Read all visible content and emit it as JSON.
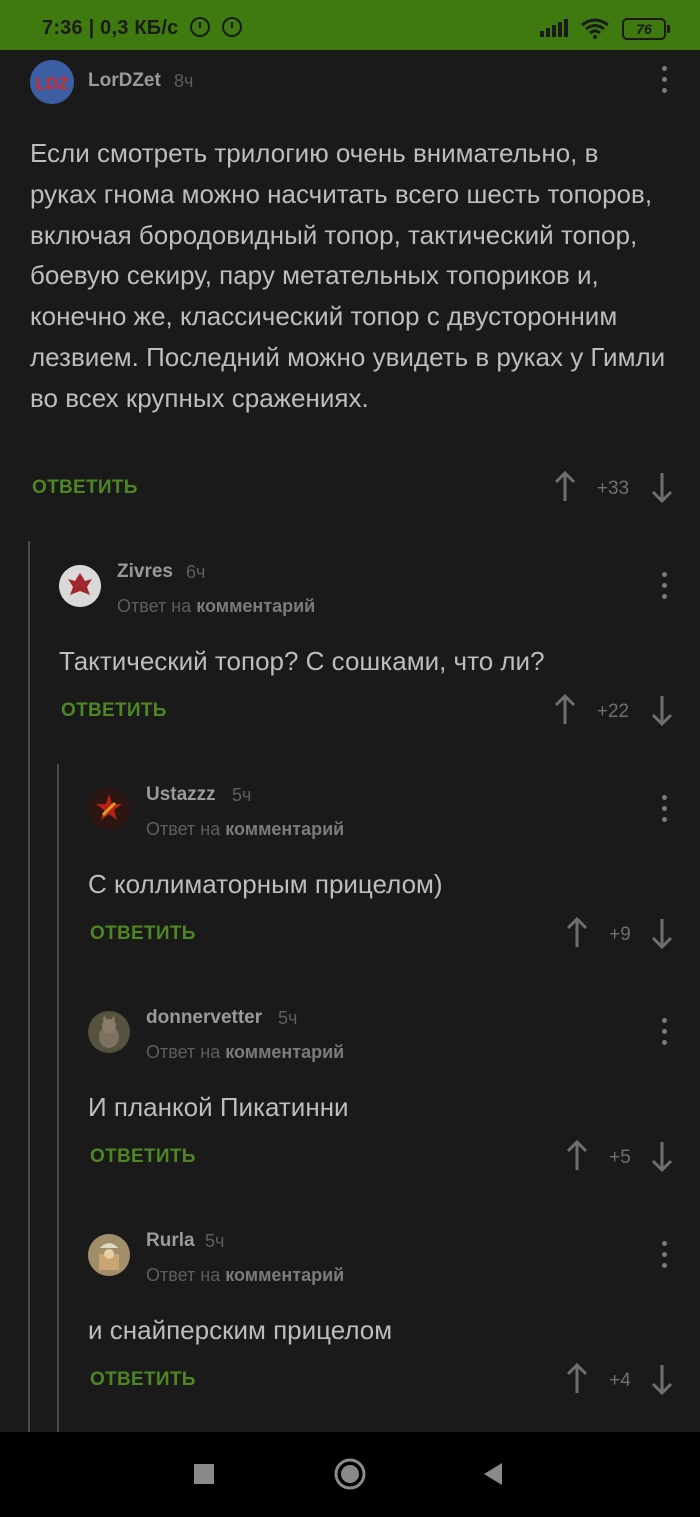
{
  "status_bar": {
    "time": "7:36",
    "speed": "0,3 КБ/с",
    "battery": "76",
    "icons": [
      "alarm-icon",
      "alarm-icon",
      "signal-icon",
      "wifi-icon",
      "battery-icon"
    ]
  },
  "comments": [
    {
      "author": "LorDZet",
      "time": "8ч",
      "avatar_text": "LDZ",
      "text": "Если смотреть трилогию очень внимательно, в руках гнома можно насчитать всего шесть топоров, включая бородовидный топор, тактический топор, боевую секиру, пару метательных топориков и, конечно же, классический топор с двусторонним лезвием. Последний можно увидеть в руках у Гимли во всех крупных сражениях.",
      "reply": "ОТВЕТИТЬ",
      "score": "+33"
    },
    {
      "author": "Zivres",
      "time": "6ч",
      "reply_prefix": "Ответ на",
      "reply_target": "комментарий",
      "text": "Тактический топор? С сошками, что ли?",
      "reply": "ОТВЕТИТЬ",
      "score": "+22"
    },
    {
      "author": "Ustazzz",
      "time": "5ч",
      "reply_prefix": "Ответ на",
      "reply_target": "комментарий",
      "text": "С коллиматорным прицелом)",
      "reply": "ОТВЕТИТЬ",
      "score": "+9"
    },
    {
      "author": "donnervetter",
      "time": "5ч",
      "reply_prefix": "Ответ на",
      "reply_target": "комментарий",
      "text": "И планкой Пикатинни",
      "reply": "ОТВЕТИТЬ",
      "score": "+5"
    },
    {
      "author": "Rurla",
      "time": "5ч",
      "reply_prefix": "Ответ на",
      "reply_target": "комментарий",
      "text": "и снайперским прицелом",
      "reply": "ОТВЕТИТЬ",
      "score": "+4"
    }
  ],
  "colors": {
    "status_bar": "#3f7a10",
    "background": "#1a1a1a",
    "accent_green": "#4d8622"
  },
  "nav_bar": {
    "icons": [
      "recent-apps-icon",
      "home-icon",
      "back-icon"
    ]
  }
}
